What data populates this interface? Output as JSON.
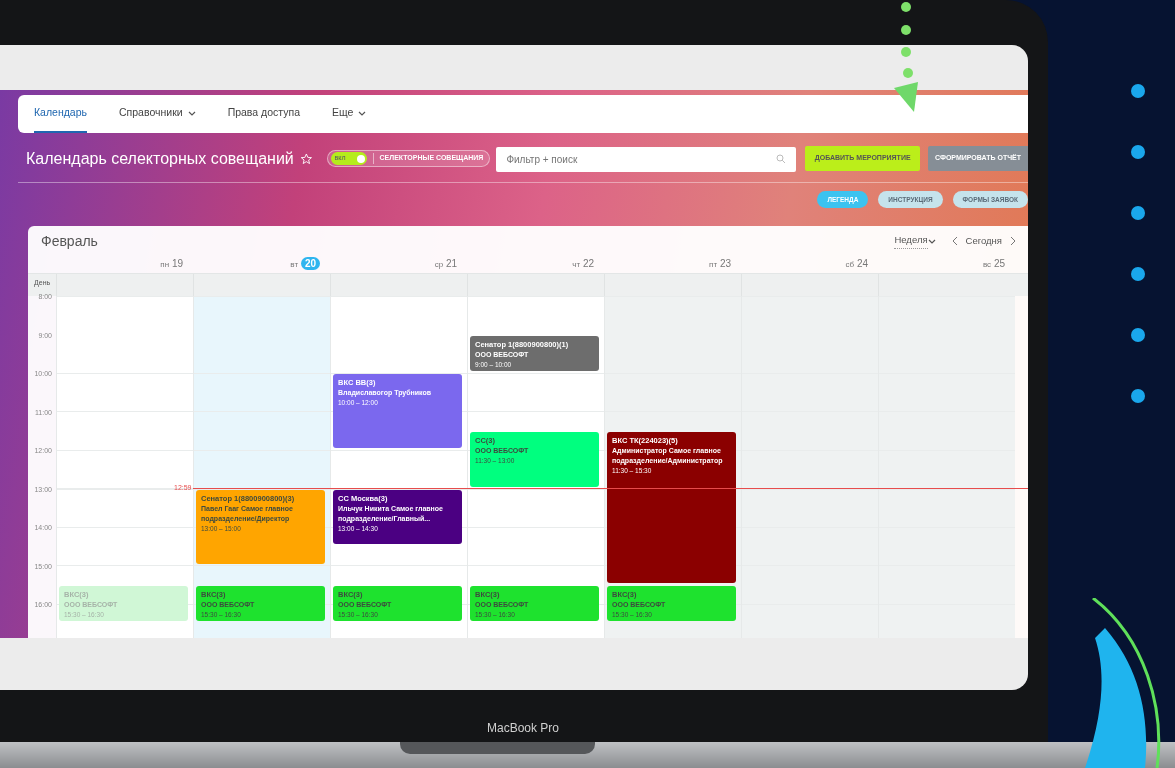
{
  "nav": {
    "tabs": [
      {
        "label": "Календарь",
        "selected": true,
        "dropdown": false
      },
      {
        "label": "Справочники",
        "selected": false,
        "dropdown": true
      },
      {
        "label": "Права доступа",
        "selected": false,
        "dropdown": false
      },
      {
        "label": "Еще",
        "selected": false,
        "dropdown": true
      }
    ]
  },
  "header": {
    "title": "Календарь селекторных совещаний",
    "toggle": {
      "label": "вкл",
      "on": true,
      "text": "СЕЛЕКТОРНЫЕ СОВЕЩАНИЯ"
    },
    "search": {
      "placeholder": "Фильтр + поиск"
    },
    "add_button": "ДОБАВИТЬ МЕРОПРИЯТИЕ",
    "report_button": "СФОРМИРОВАТЬ ОТЧЁТ"
  },
  "pills": [
    {
      "label": "ЛЕГЕНДА",
      "color": "#3cc3f0"
    },
    {
      "label": "ИНСТРУКЦИЯ",
      "color": "#c5e3ec"
    },
    {
      "label": "ФОРМЫ ЗАЯВОК",
      "color": "#c5e3ec"
    }
  ],
  "calendar": {
    "month": "Февраль",
    "view": "Неделя",
    "today_button": "Сегодня",
    "allday_label": "День",
    "now_label": "12:59",
    "hours": [
      "8:00",
      "9:00",
      "10:00",
      "11:00",
      "12:00",
      "13:00",
      "14:00",
      "15:00",
      "16:00"
    ],
    "days": [
      {
        "weekday": "пн",
        "date": "19",
        "today": false,
        "shaded": false,
        "events": [
          {
            "title": "ВКС(3)",
            "subtitle": "ООО ВЕБСОФТ",
            "time": "15:30 – 16:30",
            "color": "#d0f7d6",
            "faded": true
          }
        ]
      },
      {
        "weekday": "вт",
        "date": "20",
        "today": true,
        "shaded": false,
        "events": [
          {
            "title": "Сенатор 1(8800900800)(3)",
            "subtitle": "Павел Гааг Самое главное подразделение/Директор",
            "time": "13:00 – 15:00",
            "color": "#ffa500",
            "faded": false
          },
          {
            "title": "ВКС(3)",
            "subtitle": "ООО ВЕБСОФТ",
            "time": "15:30 – 16:30",
            "color": "#1ee22e",
            "faded": false
          }
        ]
      },
      {
        "weekday": "ср",
        "date": "21",
        "today": false,
        "shaded": false,
        "events": [
          {
            "title": "ВКС ВВ(3)",
            "subtitle": "Владиславогор Трубников",
            "time": "10:00 – 12:00",
            "color": "#7b68ee",
            "faded": false
          },
          {
            "title": "СС Москва(3)",
            "subtitle": "Ильчук Никита Самое главное подразделение/Главный...",
            "time": "13:00 – 14:30",
            "color": "#4b0082",
            "faded": false
          },
          {
            "title": "ВКС(3)",
            "subtitle": "ООО ВЕБСОФТ",
            "time": "15:30 – 16:30",
            "color": "#1ee22e",
            "faded": false
          }
        ]
      },
      {
        "weekday": "чт",
        "date": "22",
        "today": false,
        "shaded": false,
        "events": [
          {
            "title": "Сенатор 1(8800900800)(1)",
            "subtitle": "ООО ВЕБСОФТ",
            "time": "9:00 – 10:00",
            "color": "#6d6d6d",
            "faded": false
          },
          {
            "title": "СС(3)",
            "subtitle": "ООО ВЕБСОФТ",
            "time": "11:30 – 13:00",
            "color": "#00ff7f",
            "faded": false
          },
          {
            "title": "ВКС(3)",
            "subtitle": "ООО ВЕБСОФТ",
            "time": "15:30 – 16:30",
            "color": "#1ee22e",
            "faded": false
          }
        ]
      },
      {
        "weekday": "пт",
        "date": "23",
        "today": false,
        "shaded": true,
        "events": [
          {
            "title": "ВКС ТК(224023)(5)",
            "subtitle": "Администратор Самое главное подразделение/Администратор",
            "time": "11:30 – 15:30",
            "color": "#8b0000",
            "faded": false
          },
          {
            "title": "ВКС(3)",
            "subtitle": "ООО ВЕБСОФТ",
            "time": "15:30 – 16:30",
            "color": "#1ee22e",
            "faded": false
          }
        ]
      },
      {
        "weekday": "сб",
        "date": "24",
        "today": false,
        "shaded": true
      },
      {
        "weekday": "вс",
        "date": "25",
        "today": false,
        "shaded": true
      }
    ]
  },
  "device": {
    "label": "MacBook Pro"
  }
}
